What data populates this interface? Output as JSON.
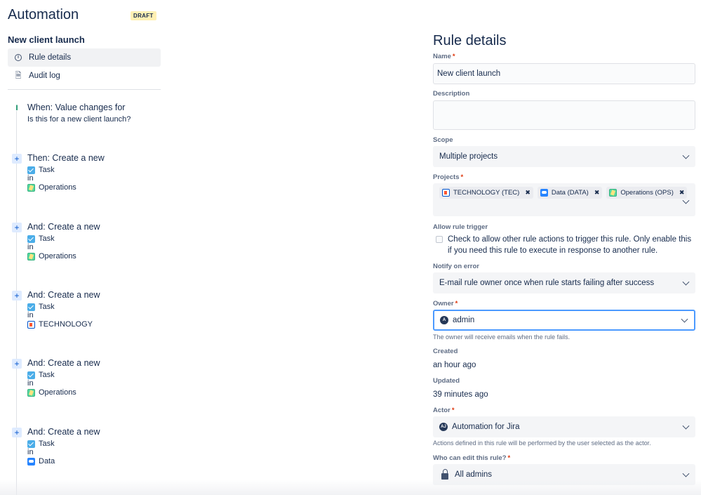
{
  "sidebar": {
    "app_title": "Automation",
    "status_badge": "DRAFT",
    "rule_name": "New client launch",
    "nav": [
      {
        "label": "Rule details",
        "icon": "info-icon",
        "active": true
      },
      {
        "label": "Audit log",
        "icon": "document-icon",
        "active": false
      }
    ],
    "trigger": {
      "title": "When: Value changes for",
      "detail": "Is this for a new client launch?"
    },
    "actions": [
      {
        "title": "Then: Create a new",
        "issue_type": "Task",
        "connector": "in",
        "project": "Operations",
        "project_icon": "operations-project-icon"
      },
      {
        "title": "And: Create a new",
        "issue_type": "Task",
        "connector": "in",
        "project": "Operations",
        "project_icon": "operations-project-icon"
      },
      {
        "title": "And: Create a new",
        "issue_type": "Task",
        "connector": "in",
        "project": "TECHNOLOGY",
        "project_icon": "technology-project-icon"
      },
      {
        "title": "And: Create a new",
        "issue_type": "Task",
        "connector": "in",
        "project": "Operations",
        "project_icon": "operations-project-icon"
      },
      {
        "title": "And: Create a new",
        "issue_type": "Task",
        "connector": "in",
        "project": "Data",
        "project_icon": "data-project-icon"
      }
    ]
  },
  "details": {
    "title": "Rule details",
    "name_label": "Name",
    "name_value": "New client launch",
    "description_label": "Description",
    "description_value": "",
    "scope_label": "Scope",
    "scope_value": "Multiple projects",
    "projects_label": "Projects",
    "projects": [
      {
        "label": "TECHNOLOGY (TEC)",
        "icon": "technology-project-icon"
      },
      {
        "label": "Data (DATA)",
        "icon": "data-project-icon"
      },
      {
        "label": "Operations (OPS)",
        "icon": "operations-project-icon"
      }
    ],
    "allow_trigger_label": "Allow rule trigger",
    "allow_trigger_text": "Check to allow other rule actions to trigger this rule. Only enable this if you need this rule to execute in response to another rule.",
    "allow_trigger_checked": false,
    "notify_label": "Notify on error",
    "notify_value": "E-mail rule owner once when rule starts failing after success",
    "owner_label": "Owner",
    "owner_initial": "A",
    "owner_value": "admin",
    "owner_helper": "The owner will receive emails when the rule fails.",
    "created_label": "Created",
    "created_value": "an hour ago",
    "updated_label": "Updated",
    "updated_value": "39 minutes ago",
    "actor_label": "Actor",
    "actor_initials": "AJ",
    "actor_value": "Automation for Jira",
    "actor_helper": "Actions defined in this rule will be performed by the user selected as the actor.",
    "editors_label": "Who can edit this rule?",
    "editors_value": "All admins",
    "required_marker": "*"
  },
  "colors": {
    "accent": "#4c9aff",
    "required": "#de350b",
    "badge_bg": "#fff0b3",
    "field_bg": "#f4f5f7",
    "text": "#172b4d",
    "muted": "#5e6c84"
  }
}
